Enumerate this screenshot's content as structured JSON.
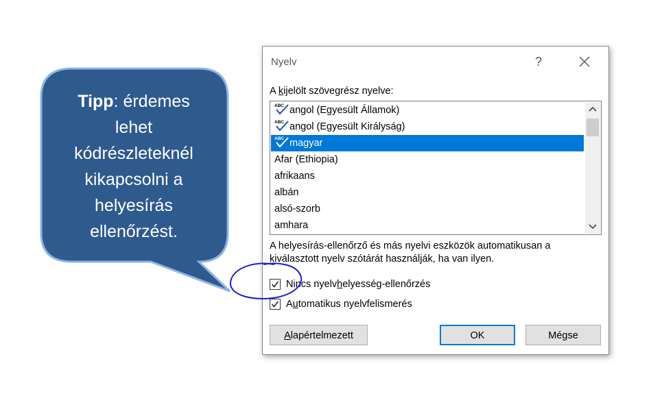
{
  "callout": {
    "bold": "Tipp",
    "text_lines": [
      ": érdemes",
      "lehet",
      "kódrészleteknél",
      "kikapcsolni a",
      "helyesírás",
      "ellenőrzést."
    ]
  },
  "dialog": {
    "title": "Nyelv",
    "help_label": "?",
    "close_icon": "close-icon",
    "list_label": {
      "pre": "A ",
      "accel": "k",
      "post": "ijelölt szövegrész nyelve:"
    },
    "languages": [
      {
        "label": "angol (Egyesült Államok)",
        "spell": true,
        "selected": false
      },
      {
        "label": "angol (Egyesült Királyság)",
        "spell": true,
        "selected": false
      },
      {
        "label": "magyar",
        "spell": true,
        "selected": true
      },
      {
        "label": "Afar (Ethiopia)",
        "spell": false,
        "selected": false
      },
      {
        "label": "afrikaans",
        "spell": false,
        "selected": false
      },
      {
        "label": "albán",
        "spell": false,
        "selected": false
      },
      {
        "label": "alsó-szorb",
        "spell": false,
        "selected": false
      },
      {
        "label": "amhara",
        "spell": false,
        "selected": false
      }
    ],
    "info_text": "A helyesírás-ellenőrző és más nyelvi eszközök automatikusan a kiválasztott nyelv szótárát használják, ha van ilyen.",
    "no_check": {
      "pre": "Nincs nyelv",
      "accel": "h",
      "post": "elyesség-ellenőrzés",
      "checked": true
    },
    "auto_detect": {
      "pre": "A",
      "accel": "u",
      "post": "tomatikus nyelvfelismerés",
      "checked": true
    },
    "buttons": {
      "default": {
        "accel": "A",
        "post": "lapértelmezett"
      },
      "ok": "OK",
      "cancel": "Mégse"
    }
  },
  "colors": {
    "bubble_fill": "#2f5a8e",
    "bubble_border": "#8db4e2",
    "selection": "#0078d7",
    "annotation": "#1a1adb"
  }
}
